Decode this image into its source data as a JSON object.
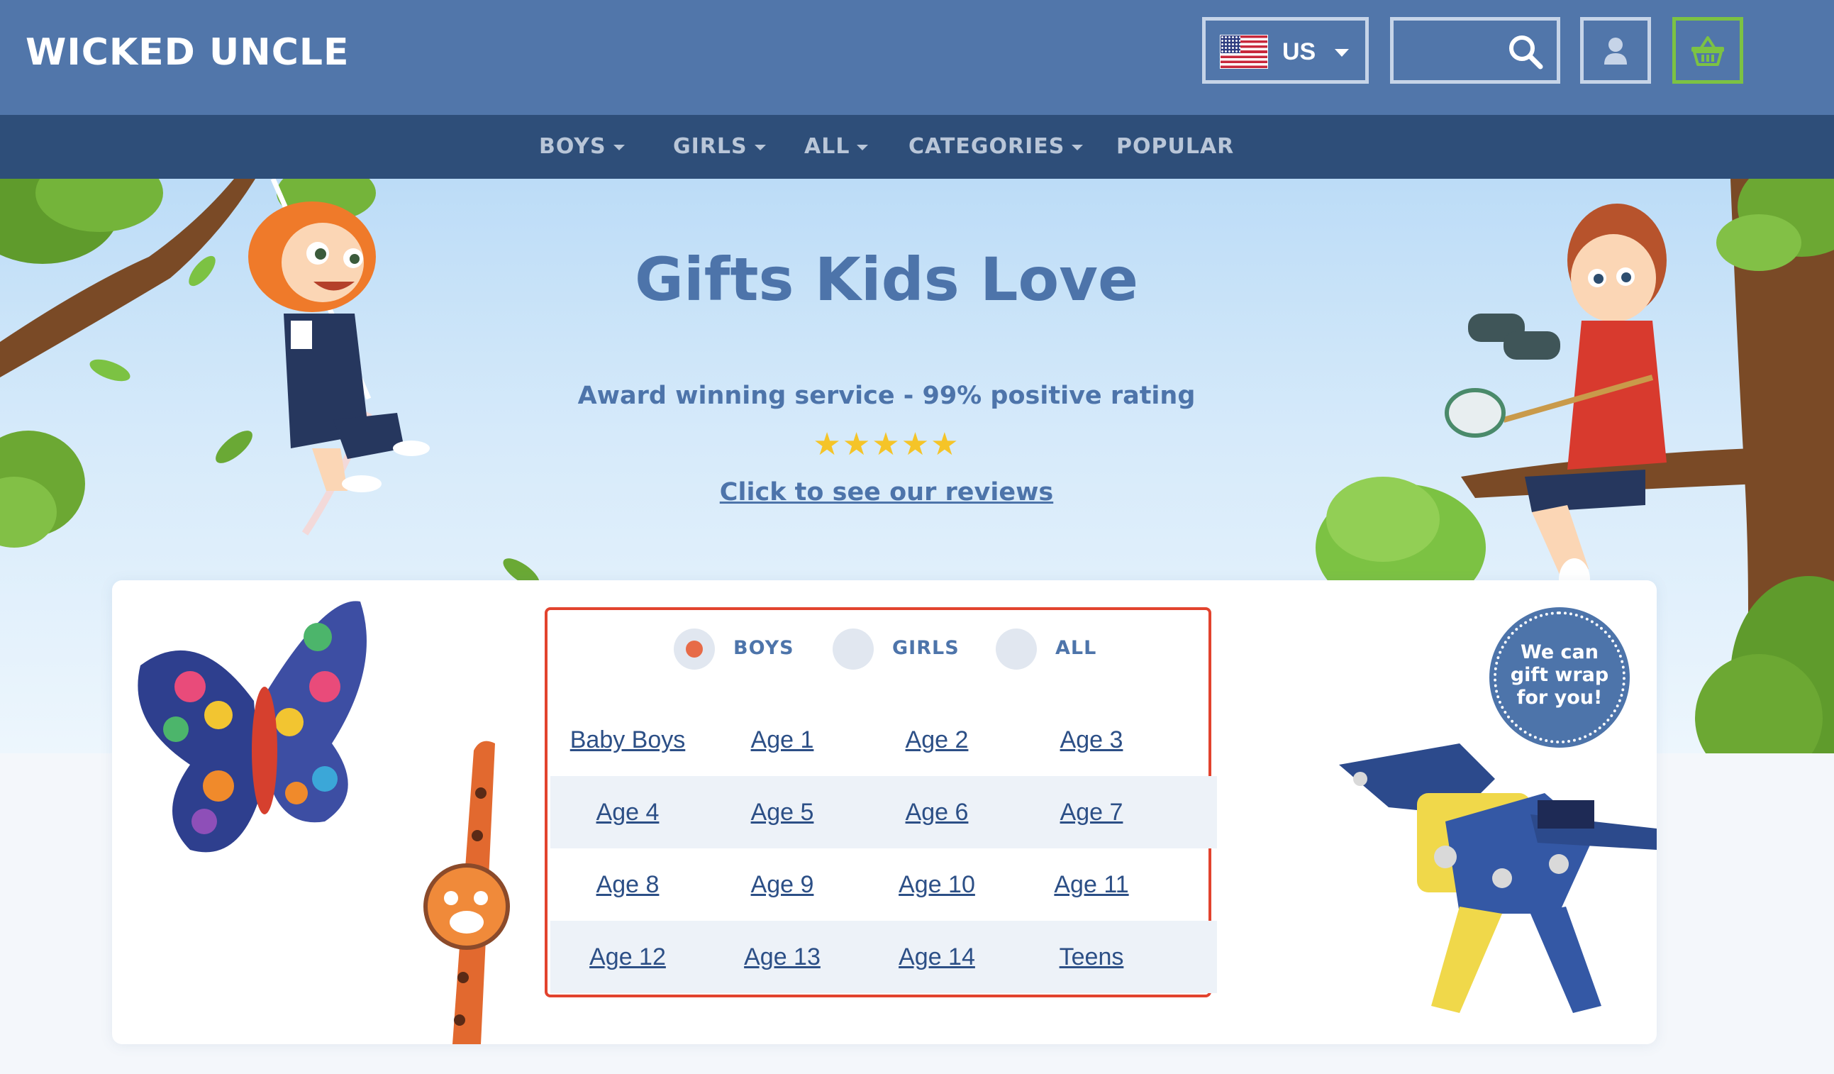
{
  "header": {
    "logo": "WICKED UNCLE",
    "country": {
      "label": "US",
      "flag_icon": "us-flag-icon"
    },
    "search_icon": "search-icon",
    "account_icon": "user-icon",
    "basket_icon": "basket-icon"
  },
  "nav": {
    "items": [
      {
        "label": "BOYS",
        "has_dropdown": true
      },
      {
        "label": "GIRLS",
        "has_dropdown": true
      },
      {
        "label": "ALL",
        "has_dropdown": true
      },
      {
        "label": "CATEGORIES",
        "has_dropdown": true
      },
      {
        "label": "POPULAR",
        "has_dropdown": false
      }
    ]
  },
  "hero": {
    "title": "Gifts Kids Love",
    "subtitle": "Award winning service - 99% positive rating",
    "stars": "★★★★★",
    "rating_stars": 5,
    "reviews_link": "Click to see our reviews"
  },
  "promo": {
    "line1": "We can",
    "line2": "gift wrap",
    "line3": "for you!"
  },
  "selector": {
    "options": [
      {
        "label": "BOYS",
        "selected": true
      },
      {
        "label": "GIRLS",
        "selected": false
      },
      {
        "label": "ALL",
        "selected": false
      }
    ],
    "rows": [
      [
        "Baby Boys",
        "Age 1",
        "Age 2",
        "Age 3"
      ],
      [
        "Age 4",
        "Age 5",
        "Age 6",
        "Age 7"
      ],
      [
        "Age 8",
        "Age 9",
        "Age 10",
        "Age 11"
      ],
      [
        "Age 12",
        "Age 13",
        "Age 14",
        "Teens"
      ]
    ]
  },
  "colors": {
    "header_bg": "#5176aa",
    "nav_bg": "#2e4e79",
    "accent_green": "#7cc243",
    "highlight_red": "#e2432e",
    "radio_selected": "#e76b48",
    "text_blue": "#4d74aa"
  }
}
